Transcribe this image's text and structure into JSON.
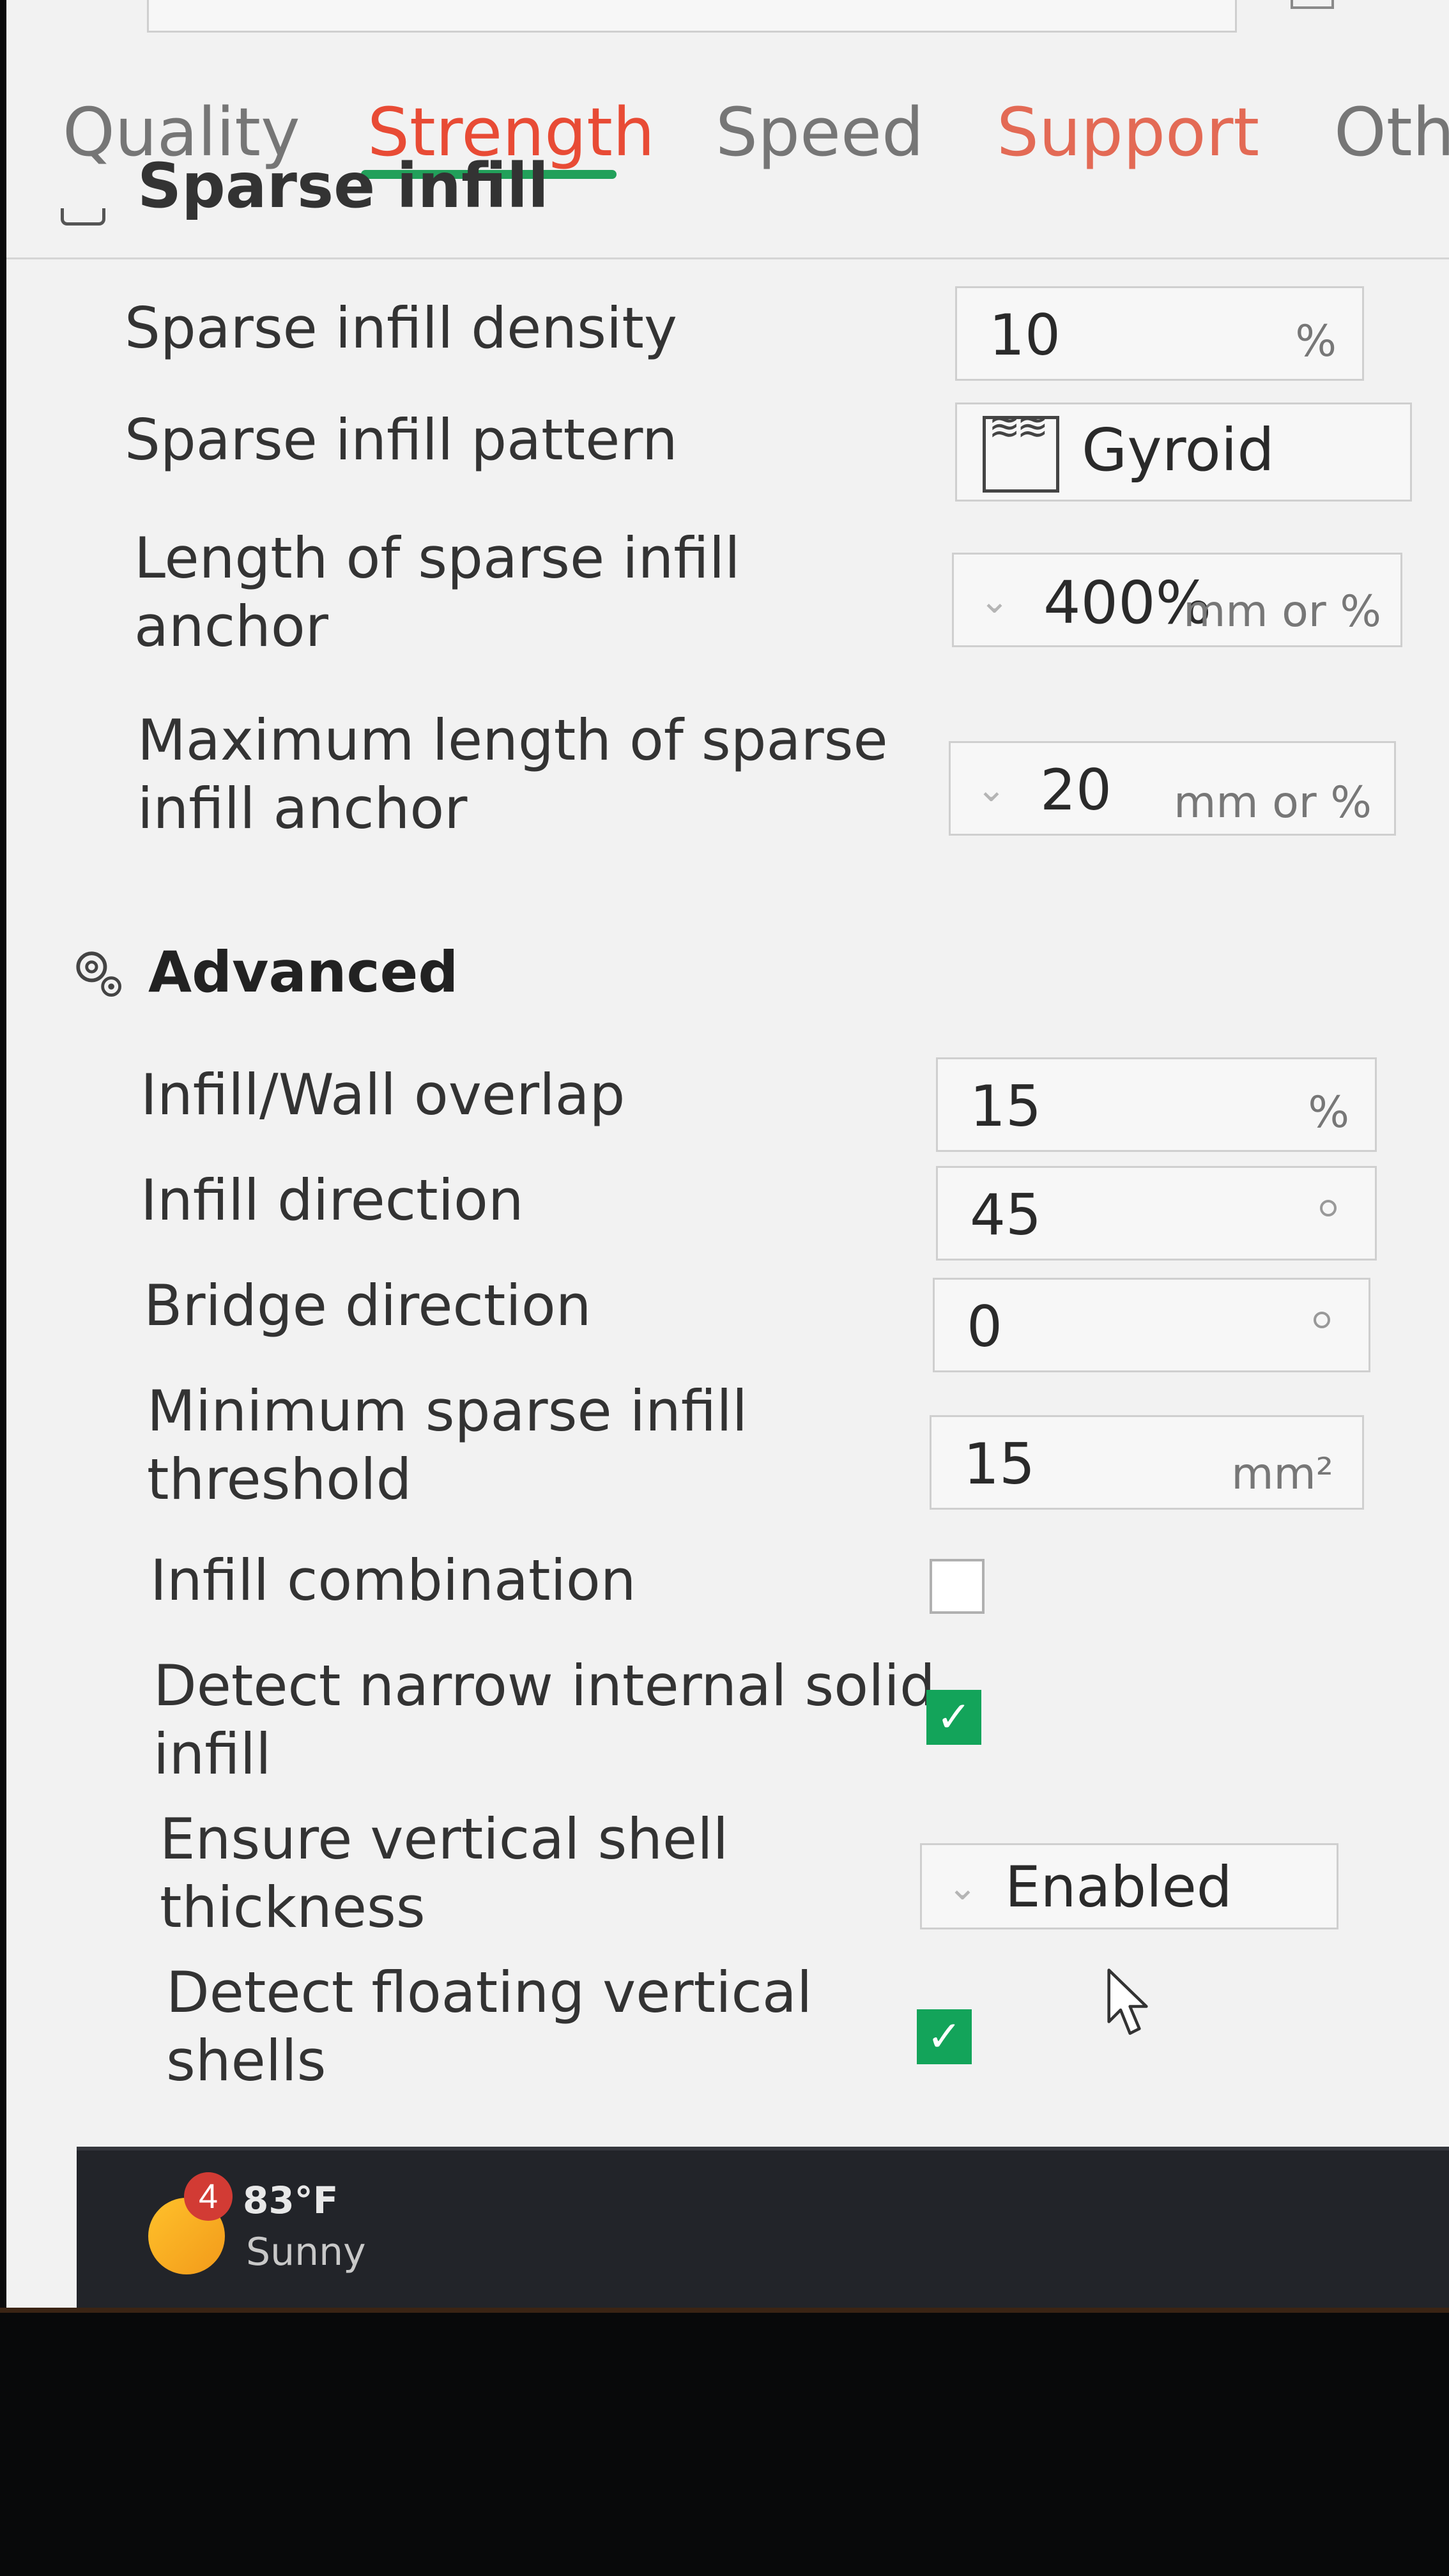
{
  "tabs": [
    {
      "label": "Quality"
    },
    {
      "label": "Strength"
    },
    {
      "label": "Speed"
    },
    {
      "label": "Support"
    },
    {
      "label": "Othe"
    }
  ],
  "sparse_infill": {
    "section_title": "Sparse infill",
    "density": {
      "label": "Sparse infill density",
      "value": "10",
      "unit": "%"
    },
    "pattern": {
      "label": "Sparse infill pattern",
      "value": "Gyroid"
    },
    "anchor_length": {
      "label_line1": "Length of sparse infill",
      "label_line2": "anchor",
      "value": "400%",
      "unit": "mm or %"
    },
    "anchor_max_length": {
      "label_line1": "Maximum length of sparse",
      "label_line2": "infill anchor",
      "value": "20",
      "unit": "mm or %"
    }
  },
  "advanced": {
    "section_title": "Advanced",
    "wall_overlap": {
      "label": "Infill/Wall overlap",
      "value": "15",
      "unit": "%"
    },
    "infill_direction": {
      "label": "Infill direction",
      "value": "45"
    },
    "bridge_direction": {
      "label": "Bridge direction",
      "value": "0"
    },
    "min_threshold": {
      "label_line1": "Minimum sparse infill",
      "label_line2": "threshold",
      "value": "15",
      "unit": "mm²"
    },
    "infill_combination": {
      "label": "Infill combination",
      "checked": false
    },
    "detect_narrow": {
      "label_line1": "Detect narrow internal solid",
      "label_line2": "infill",
      "checked": true
    },
    "vertical_shell": {
      "label_line1": "Ensure vertical shell",
      "label_line2": "thickness",
      "value": "Enabled"
    },
    "detect_floating": {
      "label_line1": "Detect floating vertical",
      "label_line2": "shells",
      "checked": true
    }
  },
  "taskbar": {
    "weather_badge": "4",
    "weather_temp": "83°F",
    "weather_condition": "Sunny"
  },
  "colors": {
    "active_tab": "#e84b35",
    "tab_underline": "#22a05a",
    "checkbox_checked": "#13a45a",
    "panel_bg": "#f2f2f2"
  }
}
